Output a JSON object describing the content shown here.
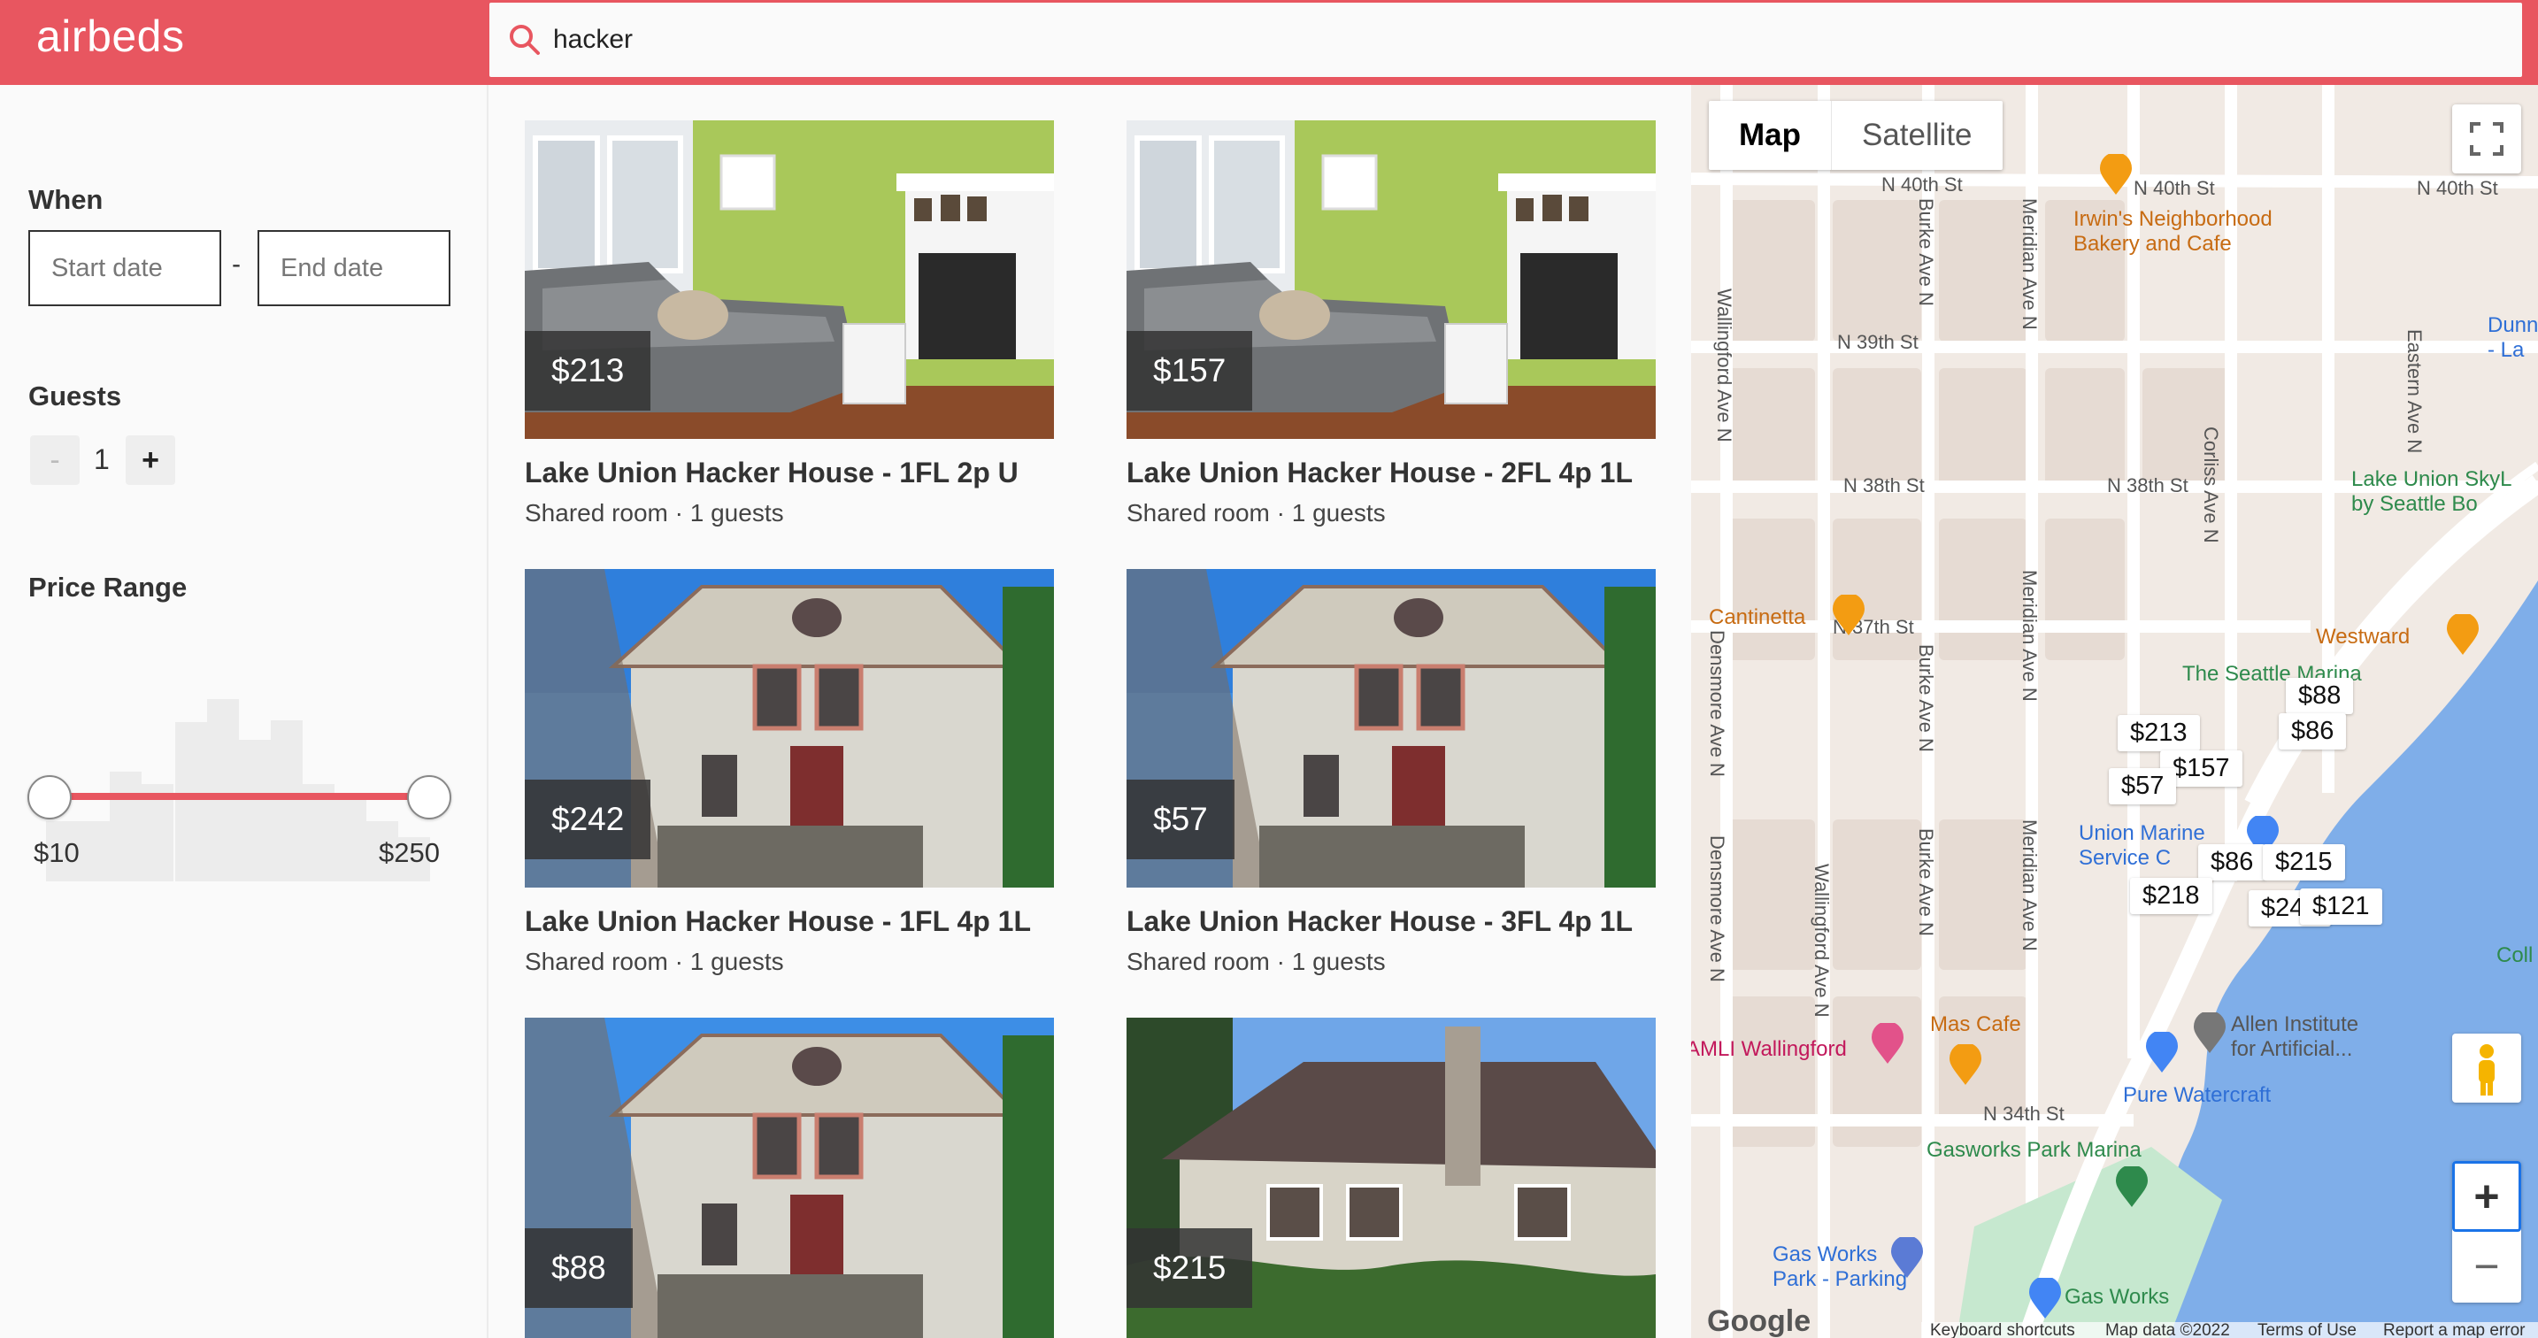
{
  "brand": {
    "logo": "airbeds",
    "accent": "#e85660"
  },
  "search": {
    "value": "hacker"
  },
  "sidebar": {
    "when_label": "When",
    "start_placeholder": "Start date",
    "end_placeholder": "End date",
    "date_separator": "-",
    "guests_label": "Guests",
    "guests_decrement": "-",
    "guests_value": "1",
    "guests_increment": "+",
    "price_label": "Price Range",
    "price_min": "$10",
    "price_max": "$250"
  },
  "listings": [
    {
      "price": "$213",
      "title": "Lake Union Hacker House - 1FL 2p U",
      "subtitle": "Shared room · 1 guests",
      "photo": "living-room"
    },
    {
      "price": "$157",
      "title": "Lake Union Hacker House - 2FL 4p 1L",
      "subtitle": "Shared room · 1 guests",
      "photo": "living-room"
    },
    {
      "price": "$242",
      "title": "Lake Union Hacker House - 1FL 4p 1L",
      "subtitle": "Shared room · 1 guests",
      "photo": "house-exterior"
    },
    {
      "price": "$57",
      "title": "Lake Union Hacker House - 3FL 4p 1L",
      "subtitle": "Shared room · 1 guests",
      "photo": "house-exterior"
    },
    {
      "price": "$88",
      "title": "",
      "subtitle": "",
      "photo": "house-exterior"
    },
    {
      "price": "$215",
      "title": "",
      "subtitle": "",
      "photo": "dark-roof-house"
    }
  ],
  "map": {
    "tabs": [
      "Map",
      "Satellite"
    ],
    "markers": [
      "$88",
      "$213",
      "$86",
      "$157",
      "$57",
      "$86",
      "$215",
      "$218",
      "$242",
      "$121"
    ],
    "streets": [
      "N 40th St",
      "N 40th St",
      "N 40th St",
      "N 39th St",
      "N 38th St",
      "N 38th St",
      "N 37th St",
      "N 34th St",
      "Wallingford Ave N",
      "Burke Ave N",
      "Meridian Ave N",
      "Eastern Ave N",
      "Corliss Ave N",
      "Densmore Ave N",
      "Densmore Ave N",
      "Wallingford Ave N",
      "Burke Ave N",
      "Meridian Ave N",
      "Burke Ave N",
      "Meridian Ave N"
    ],
    "places": {
      "irwins": "Irwin's Neighborhood\nBakery and Cafe",
      "cantinetta": "Cantinetta",
      "westward": "Westward",
      "seattle_marina": "The Seattle Marina",
      "union_marine": "Union Marine\nService C",
      "lake_union_sky": "Lake Union SkyL\nby Seattle Bo",
      "dunn": "Dunn\n- La",
      "amli": "AMLI Wallingford",
      "mas_cafe": "Mas Cafe",
      "allen_institute": "Allen Institute\nfor Artificial...",
      "pure_watercraft": "Pure Watercraft",
      "gasworks_marina": "Gasworks Park Marina",
      "gasworks_parking": "Gas Works\nPark - Parking",
      "gasworks": "Gas Works",
      "coll": "Coll"
    },
    "footer": {
      "google": "Google",
      "shortcuts": "Keyboard shortcuts",
      "mapdata": "Map data ©2022",
      "terms": "Terms of Use",
      "report": "Report a map error"
    },
    "zoom_in": "+",
    "zoom_out": "−"
  }
}
